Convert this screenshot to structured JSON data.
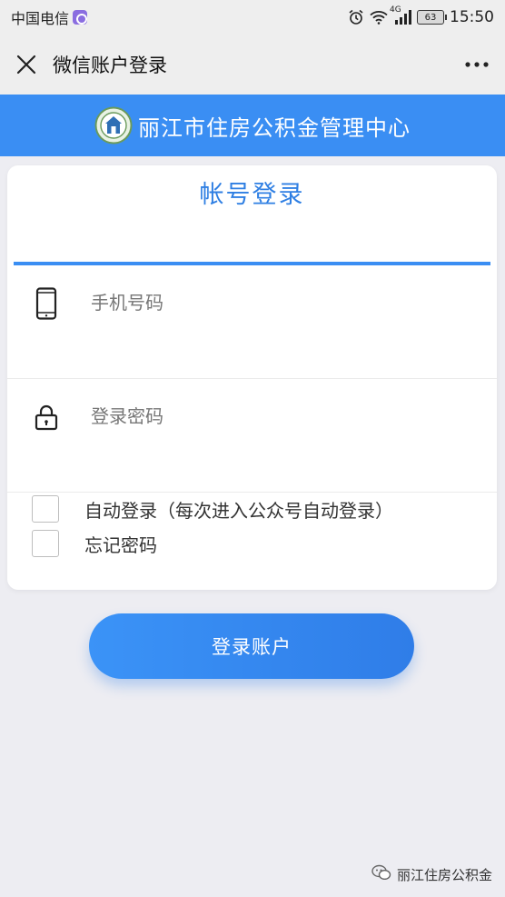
{
  "status_bar": {
    "carrier": "中国电信",
    "signal_label": "4G",
    "battery": "63",
    "time": "15:50"
  },
  "title_bar": {
    "title": "微信账户登录"
  },
  "banner": {
    "org_name": "丽江市住房公积金管理中心"
  },
  "login_card": {
    "title": "帐号登录",
    "phone_placeholder": "手机号码",
    "password_placeholder": "登录密码",
    "auto_login_label": "自动登录（每次进入公众号自动登录）",
    "forget_password_label": "忘记密码"
  },
  "login_button": {
    "label": "登录账户"
  },
  "watermark": {
    "text": "丽江住房公积金"
  },
  "colors": {
    "accent": "#3a8ef3",
    "title_blue": "#2f7fe3",
    "background": "#ededf2"
  },
  "icons": [
    "carrier-badge-icon",
    "alarm-icon",
    "wifi-icon",
    "signal-icon",
    "battery-icon",
    "close-icon",
    "more-icon",
    "emblem-logo",
    "phone-icon",
    "lock-icon",
    "wechat-icon"
  ]
}
